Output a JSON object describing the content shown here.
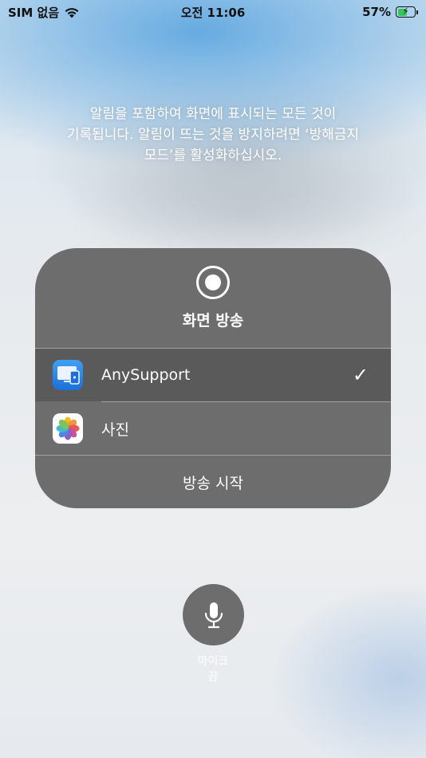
{
  "status_bar": {
    "carrier": "SIM 없음",
    "time": "오전 11:06",
    "battery_percent": "57%",
    "battery_level": 0.57
  },
  "warning_lines": [
    "알림을 포함하여 화면에 표시되는 모든 것이",
    "기록됩니다. 알림이 뜨는 것을 방지하려면 ‘방해금지",
    "모드’를 활성화하십시오."
  ],
  "panel": {
    "title": "화면 방송",
    "apps": [
      {
        "name": "AnySupport",
        "icon": "anysupport-app-icon",
        "selected": true
      },
      {
        "name": "사진",
        "icon": "photos-app-icon",
        "selected": false
      }
    ],
    "check_glyph": "✓",
    "start_label": "방송 시작"
  },
  "mic": {
    "label_line1": "마이크",
    "label_line2": "끔",
    "icon": "microphone-icon"
  },
  "colors": {
    "panel_bg": "#6d6d6d",
    "selected_row_bg": "#5a5a5a",
    "battery_green": "#34c759",
    "sky_blue": "#60a8e0"
  }
}
